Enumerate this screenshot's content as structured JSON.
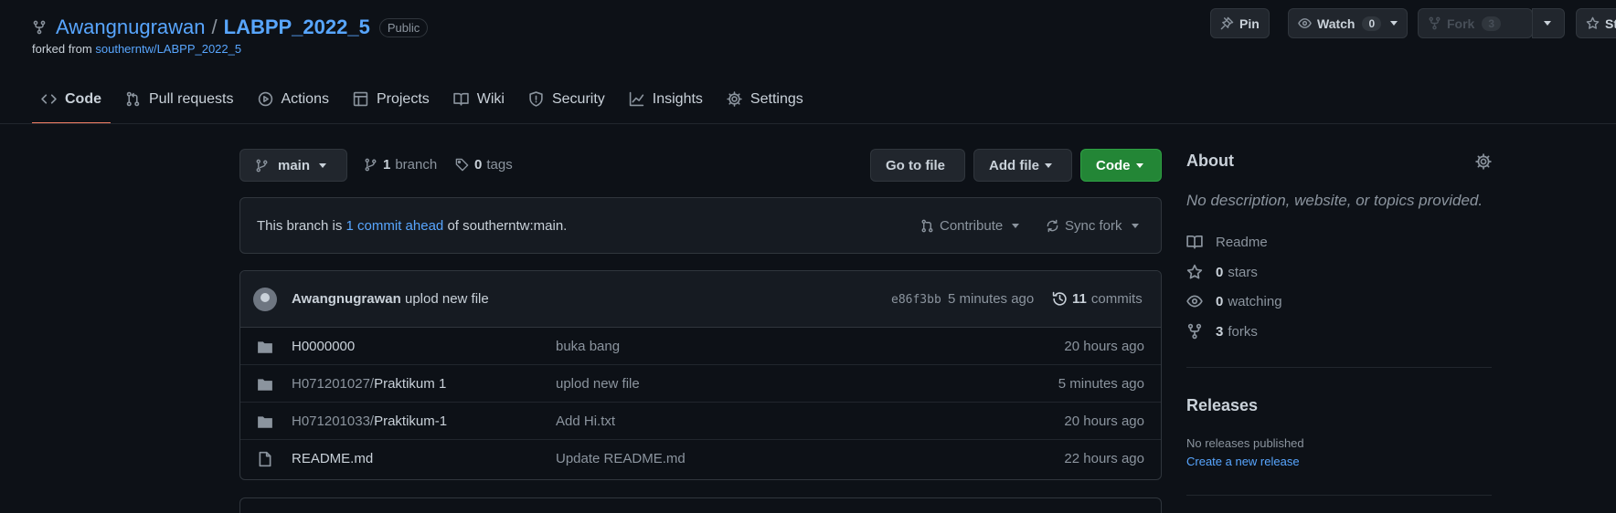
{
  "repo": {
    "owner": "Awangnugrawan",
    "separator": "/",
    "name": "LABPP_2022_5",
    "visibility": "Public",
    "forked_from_prefix": "forked from",
    "forked_from": "southerntw/LABPP_2022_5"
  },
  "header_buttons": {
    "pin": "Pin",
    "watch": "Watch",
    "watch_count": "0",
    "fork": "Fork",
    "fork_count": "3",
    "star": "Sta"
  },
  "tabs": [
    {
      "label": "Code",
      "icon": "code-icon",
      "active": true
    },
    {
      "label": "Pull requests",
      "icon": "pull-request-icon"
    },
    {
      "label": "Actions",
      "icon": "play-icon"
    },
    {
      "label": "Projects",
      "icon": "table-icon"
    },
    {
      "label": "Wiki",
      "icon": "book-icon"
    },
    {
      "label": "Security",
      "icon": "shield-icon"
    },
    {
      "label": "Insights",
      "icon": "graph-icon"
    },
    {
      "label": "Settings",
      "icon": "gear-icon"
    }
  ],
  "branch": {
    "current": "main",
    "branch_count": "1",
    "branch_label": "branch",
    "tag_count": "0",
    "tag_label": "tags"
  },
  "actions": {
    "go_to_file": "Go to file",
    "add_file": "Add file",
    "code": "Code"
  },
  "ahead_banner": {
    "prefix": "This branch is",
    "link": "1 commit ahead",
    "suffix": "of southerntw:main.",
    "contribute": "Contribute",
    "sync_fork": "Sync fork"
  },
  "latest_commit": {
    "author": "Awangnugrawan",
    "message": "uplod new file",
    "hash": "e86f3bb",
    "time": "5 minutes ago",
    "count": "11",
    "count_label": "commits"
  },
  "files": [
    {
      "prefix": "",
      "name": "H0000000",
      "type": "folder",
      "message": "buka bang",
      "time": "20 hours ago"
    },
    {
      "prefix": "H071201027/",
      "name": "Praktikum 1",
      "type": "folder",
      "message": "uplod new file",
      "time": "5 minutes ago"
    },
    {
      "prefix": "H071201033/",
      "name": "Praktikum-1",
      "type": "folder",
      "message": "Add Hi.txt",
      "time": "20 hours ago"
    },
    {
      "prefix": "",
      "name": "README.md",
      "type": "file",
      "message": "Update README.md",
      "time": "22 hours ago"
    }
  ],
  "about": {
    "title": "About",
    "description": "No description, website, or topics provided.",
    "readme": "Readme",
    "stars_count": "0",
    "stars_label": "stars",
    "watching_count": "0",
    "watching_label": "watching",
    "forks_count": "3",
    "forks_label": "forks"
  },
  "releases": {
    "title": "Releases",
    "none": "No releases published",
    "create_link": "Create a new release"
  },
  "colors": {
    "background": "#0d1117",
    "link": "#58a6ff",
    "primary_button": "#238636",
    "active_tab_underline": "#f78166"
  }
}
